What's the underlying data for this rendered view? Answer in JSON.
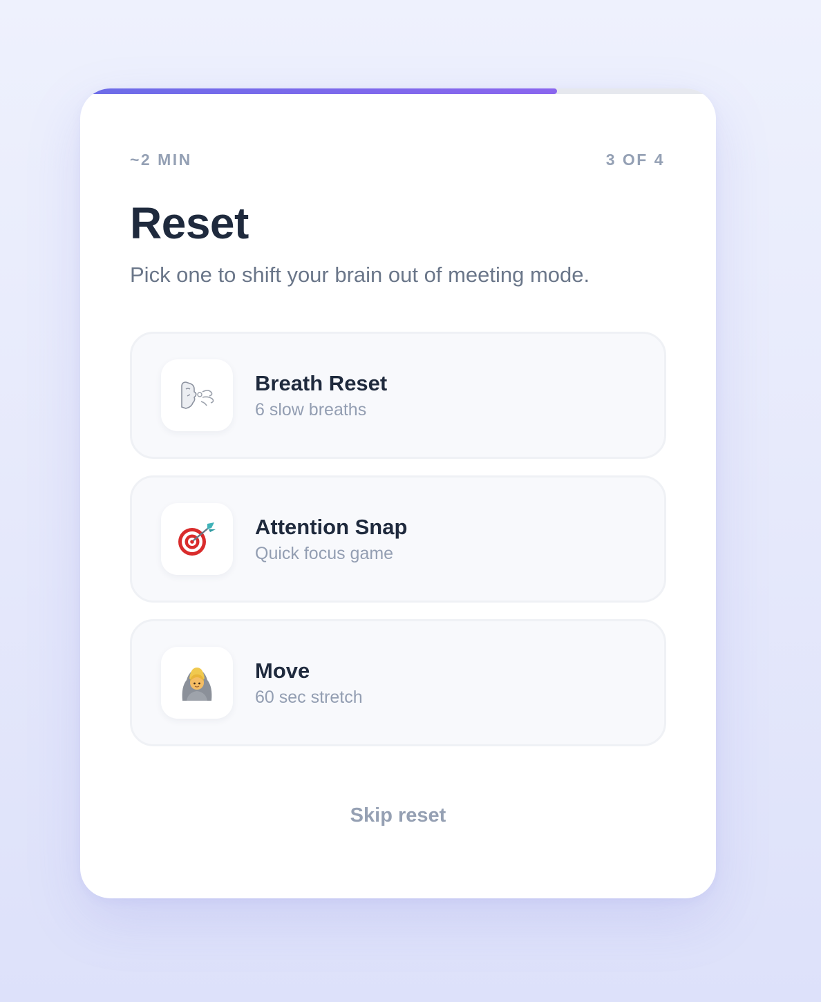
{
  "progress": {
    "fraction": 0.75,
    "color_start": "#6c6ce8",
    "color_end": "#8a66ee"
  },
  "meta": {
    "duration": "~2 MIN",
    "step": "3 OF 4"
  },
  "title": "Reset",
  "subtitle": "Pick one to shift your brain out of meeting mode.",
  "options": [
    {
      "icon": "wind-face-icon",
      "title": "Breath Reset",
      "subtitle": "6 slow breaths"
    },
    {
      "icon": "target-dart-icon",
      "title": "Attention Snap",
      "subtitle": "Quick focus game"
    },
    {
      "icon": "person-stretch-icon",
      "title": "Move",
      "subtitle": "60 sec stretch"
    }
  ],
  "skip_label": "Skip reset"
}
